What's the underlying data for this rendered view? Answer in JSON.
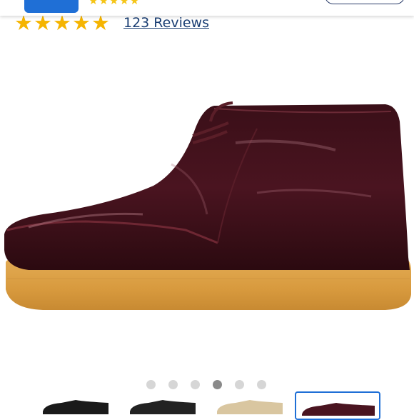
{
  "rating": {
    "stars": 5,
    "reviews_label": "123 Reviews"
  },
  "icons": {
    "star": "star-icon"
  },
  "carousel": {
    "total_images": 6,
    "active_index": 3
  },
  "thumbnails": [
    {
      "color": "#1a1a1a"
    },
    {
      "color": "#222222"
    },
    {
      "color": "#d9c6a0"
    },
    {
      "color": "#4a1420"
    }
  ],
  "colors": {
    "accent": "#1f6fd6",
    "star": "#f5b400",
    "link": "#1a3e73"
  }
}
